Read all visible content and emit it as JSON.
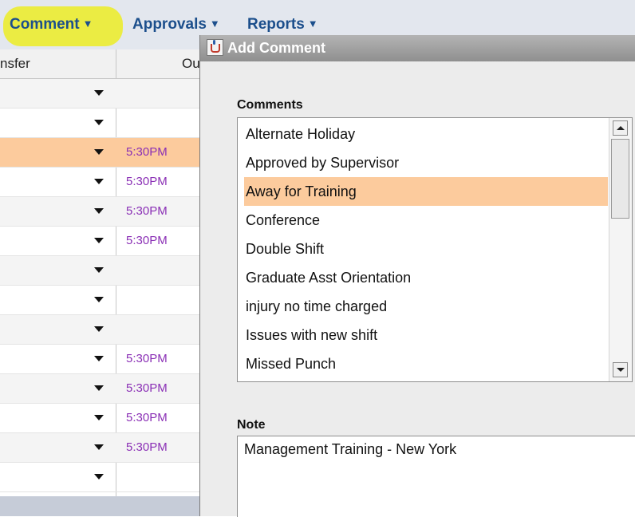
{
  "menubar": {
    "items": [
      {
        "label": "Comment",
        "highlight_color": "#ecec24"
      },
      {
        "label": "Approvals"
      },
      {
        "label": "Reports"
      }
    ]
  },
  "grid": {
    "columns": [
      "nsfer",
      "Ou"
    ],
    "rows": [
      {
        "time": "",
        "selected": false
      },
      {
        "time": "",
        "selected": false
      },
      {
        "time": "5:30PM",
        "selected": true
      },
      {
        "time": "5:30PM",
        "selected": false
      },
      {
        "time": "5:30PM",
        "selected": false
      },
      {
        "time": "5:30PM",
        "selected": false
      },
      {
        "time": "",
        "selected": false
      },
      {
        "time": "",
        "selected": false
      },
      {
        "time": "",
        "selected": false
      },
      {
        "time": "5:30PM",
        "selected": false
      },
      {
        "time": "5:30PM",
        "selected": false
      },
      {
        "time": "5:30PM",
        "selected": false
      },
      {
        "time": "5:30PM",
        "selected": false
      },
      {
        "time": "",
        "selected": false
      }
    ],
    "time_color": "#8a2fb5",
    "selected_color": "#fccb9d"
  },
  "dialog": {
    "title": "Add Comment",
    "icon": "java-cup-icon",
    "comments_label": "Comments",
    "comments": [
      "Alternate Holiday",
      "Approved  by Supervisor",
      "Away for Training",
      "Conference",
      "Double Shift",
      "Graduate Asst Orientation",
      "injury  no time charged",
      "Issues with new shift",
      "Missed Punch"
    ],
    "selected_comment": "Away for Training",
    "note_label": "Note",
    "note_value": "Management Training - New York"
  }
}
